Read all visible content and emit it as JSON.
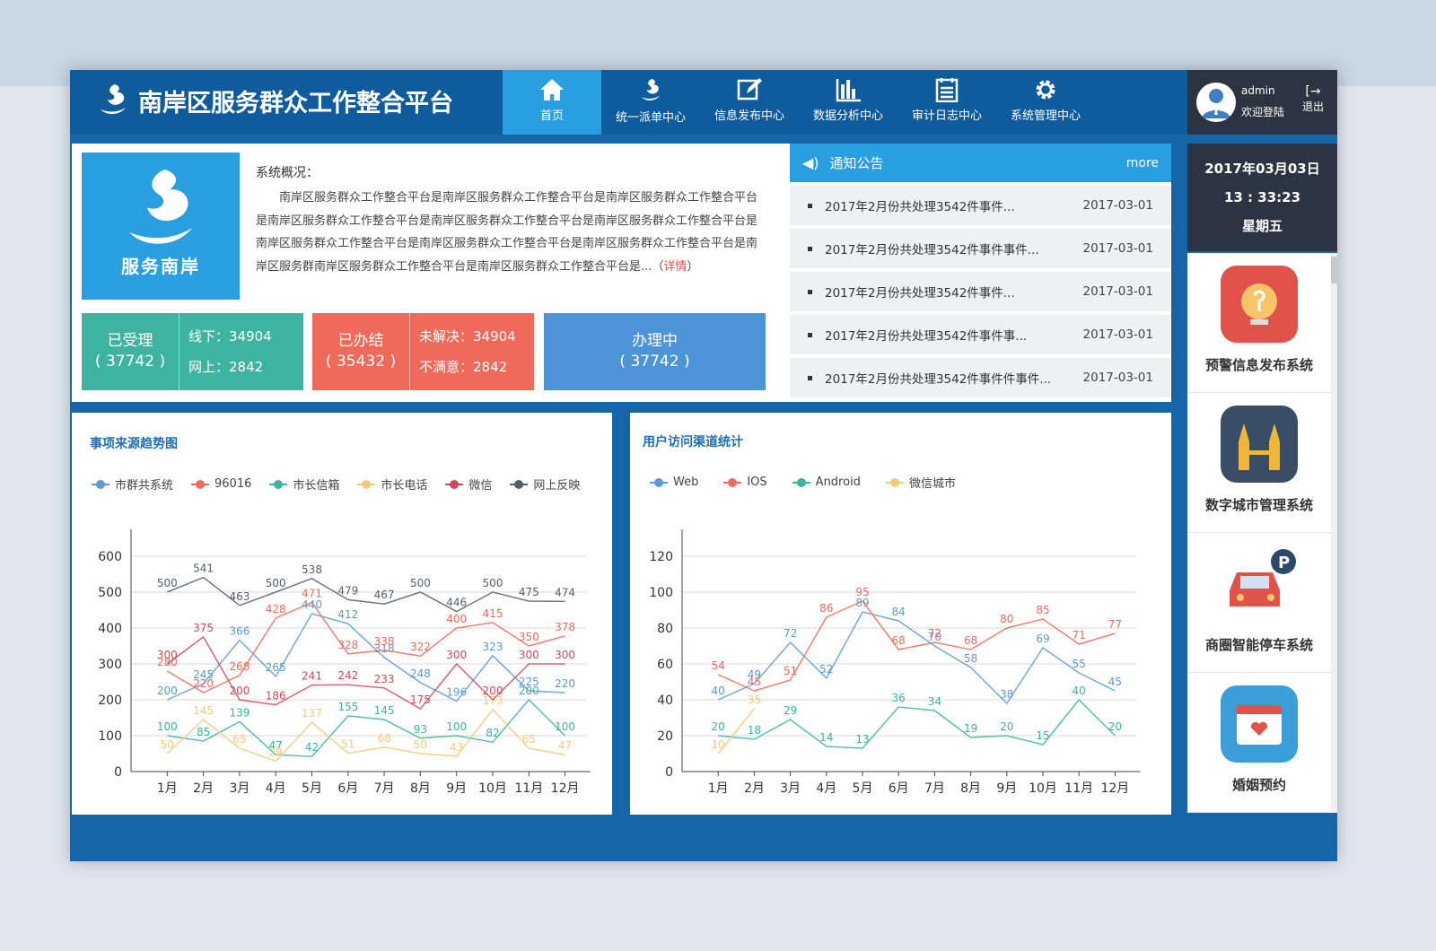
{
  "header": {
    "title": "南岸区服务群众工作整合平台",
    "nav": [
      {
        "label": "首页",
        "icon": "home-icon",
        "active": true
      },
      {
        "label": "统一派单中心",
        "icon": "logo-swirl-icon"
      },
      {
        "label": "信息发布中心",
        "icon": "edit-icon"
      },
      {
        "label": "数据分析中心",
        "icon": "bar-chart-icon"
      },
      {
        "label": "审计日志中心",
        "icon": "log-list-icon"
      },
      {
        "label": "系统管理中心",
        "icon": "gear-icon"
      }
    ]
  },
  "user": {
    "name": "admin",
    "welcome": "欢迎登陆",
    "logout": "退出"
  },
  "datetime": {
    "date": "2017年03月03日",
    "time": "13 : 33:23",
    "weekday": "星期五"
  },
  "overview": {
    "logo_text": "服务南岸",
    "title": "系统概况：",
    "text": "南岸区服务群众工作整合平台是南岸区服务群众工作整合平台是南岸区服务群众工作整合平台是南岸区服务群众工作整合平台是南岸区服务群众工作整合平台是南岸区服务群众工作整合平台是南岸区服务群众工作整合平台是南岸区服务群众工作整合平台是南岸区服务群众工作整合平台是南岸区服务群南岸区服务群众工作整合平台是南岸区服务群众工作整合平台是...（",
    "detail": "详情",
    "close": "）"
  },
  "stats": [
    {
      "label": "已受理",
      "value": "( 37742 )",
      "sub": [
        "线下：34904",
        "网上：2842"
      ],
      "color": "#3db3a0"
    },
    {
      "label": "已办结",
      "value": "( 35432 )",
      "sub": [
        "未解决：34904",
        "不满意：2842"
      ],
      "color": "#ef6a5a"
    },
    {
      "label": "办理中",
      "value": "( 37742 )",
      "sub": [],
      "color": "#4d94d6"
    }
  ],
  "notice": {
    "title": "通知公告",
    "more": "more",
    "items": [
      {
        "text": "2017年2月份共处理3542件事件...",
        "date": "2017-03-01"
      },
      {
        "text": "2017年2月份共处理3542件事件事件...",
        "date": "2017-03-01"
      },
      {
        "text": "2017年2月份共处理3542件事件...",
        "date": "2017-03-01"
      },
      {
        "text": "2017年2月份共处理3542件事件事...",
        "date": "2017-03-01"
      },
      {
        "text": "2017年2月份共处理3542件事件件事件...",
        "date": "2017-03-01"
      }
    ]
  },
  "apps": [
    {
      "label": "预警信息发布系统",
      "color": "#e0524a"
    },
    {
      "label": "数字城市管理系统",
      "color": "#3a4d66"
    },
    {
      "label": "商圈智能停车系统",
      "color": "#ffffff"
    },
    {
      "label": "婚姻预约",
      "color": "#3a9fd8"
    }
  ],
  "chart_data": [
    {
      "type": "line",
      "title": "事项来源趋势图",
      "categories": [
        "1月",
        "2月",
        "3月",
        "4月",
        "5月",
        "6月",
        "7月",
        "8月",
        "9月",
        "10月",
        "11月",
        "12月"
      ],
      "ylim": [
        0,
        600
      ],
      "yticks": [
        0,
        100,
        200,
        300,
        400,
        500,
        600
      ],
      "grid": true,
      "legend": "top-left",
      "series": [
        {
          "name": "市群共系统",
          "color": "#5b9bd5",
          "values": [
            200,
            245,
            366,
            265,
            440,
            412,
            318,
            248,
            196,
            323,
            225,
            220
          ]
        },
        {
          "name": "96016",
          "color": "#ef6a5a",
          "values": [
            280,
            220,
            268,
            428,
            471,
            328,
            338,
            322,
            400,
            415,
            350,
            378
          ]
        },
        {
          "name": "市长信箱",
          "color": "#3db3a0",
          "values": [
            100,
            85,
            139,
            47,
            42,
            155,
            145,
            93,
            100,
            82,
            200,
            100
          ]
        },
        {
          "name": "市长电话",
          "color": "#f5c97a",
          "values": [
            50,
            145,
            65,
            29,
            137,
            51,
            68,
            50,
            43,
            173,
            65,
            47
          ]
        },
        {
          "name": "微信",
          "color": "#d04a55",
          "values": [
            300,
            375,
            200,
            186,
            241,
            242,
            233,
            175,
            300,
            200,
            300,
            300
          ]
        },
        {
          "name": "网上反映",
          "color": "#555f6b",
          "values": [
            500,
            541,
            463,
            500,
            538,
            479,
            467,
            500,
            446,
            500,
            475,
            474
          ]
        }
      ]
    },
    {
      "type": "line",
      "title": "用户访问渠道统计",
      "categories": [
        "1月",
        "2月",
        "3月",
        "4月",
        "5月",
        "6月",
        "7月",
        "8月",
        "9月",
        "10月",
        "11月",
        "12月"
      ],
      "ylim": [
        0,
        120
      ],
      "yticks": [
        0,
        20,
        40,
        60,
        80,
        100,
        120
      ],
      "grid": true,
      "legend": "top-left",
      "series": [
        {
          "name": "Web",
          "color": "#5b9bd5",
          "values": [
            40,
            49,
            72,
            52,
            89,
            84,
            70,
            58,
            38,
            69,
            55,
            45
          ]
        },
        {
          "name": "IOS",
          "color": "#ef6a5a",
          "values": [
            54,
            45,
            51,
            86,
            95,
            68,
            72,
            68,
            80,
            85,
            71,
            77
          ]
        },
        {
          "name": "Android",
          "color": "#3db3a0",
          "values": [
            20,
            18,
            29,
            14,
            13,
            36,
            34,
            19,
            20,
            15,
            40,
            20
          ]
        },
        {
          "name": "微信城市",
          "color": "#f5c97a",
          "values": [
            10,
            35,
            null,
            null,
            null,
            null,
            null,
            null,
            null,
            null,
            null,
            null
          ]
        }
      ]
    }
  ]
}
